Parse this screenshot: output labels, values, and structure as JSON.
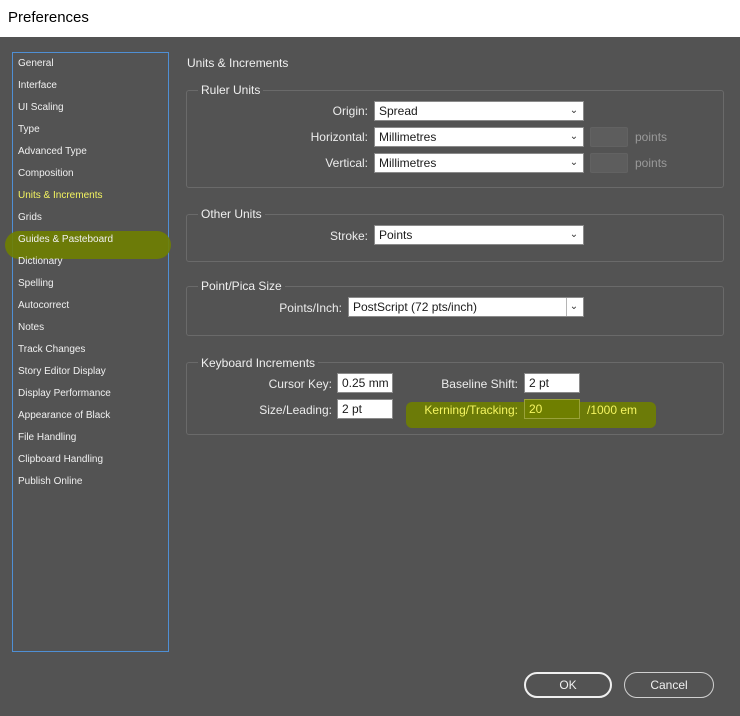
{
  "window": {
    "title": "Preferences"
  },
  "sidebar": {
    "items": [
      {
        "label": "General"
      },
      {
        "label": "Interface"
      },
      {
        "label": "UI Scaling"
      },
      {
        "label": "Type"
      },
      {
        "label": "Advanced Type"
      },
      {
        "label": "Composition"
      },
      {
        "label": "Units & Increments",
        "selected": true
      },
      {
        "label": "Grids"
      },
      {
        "label": "Guides & Pasteboard"
      },
      {
        "label": "Dictionary"
      },
      {
        "label": "Spelling"
      },
      {
        "label": "Autocorrect"
      },
      {
        "label": "Notes"
      },
      {
        "label": "Track Changes"
      },
      {
        "label": "Story Editor Display"
      },
      {
        "label": "Display Performance"
      },
      {
        "label": "Appearance of Black"
      },
      {
        "label": "File Handling"
      },
      {
        "label": "Clipboard Handling"
      },
      {
        "label": "Publish Online"
      }
    ]
  },
  "main": {
    "heading": "Units & Increments",
    "ruler_units": {
      "title": "Ruler Units",
      "origin_label": "Origin:",
      "origin_value": "Spread",
      "horizontal_label": "Horizontal:",
      "horizontal_value": "Millimetres",
      "horizontal_unit": "points",
      "vertical_label": "Vertical:",
      "vertical_value": "Millimetres",
      "vertical_unit": "points"
    },
    "other_units": {
      "title": "Other Units",
      "stroke_label": "Stroke:",
      "stroke_value": "Points"
    },
    "point_pica": {
      "title": "Point/Pica Size",
      "points_inch_label": "Points/Inch:",
      "points_inch_value": "PostScript (72 pts/inch)"
    },
    "keyboard_increments": {
      "title": "Keyboard Increments",
      "cursor_key_label": "Cursor Key:",
      "cursor_key_value": "0.25 mm",
      "baseline_shift_label": "Baseline Shift:",
      "baseline_shift_value": "2 pt",
      "size_leading_label": "Size/Leading:",
      "size_leading_value": "2 pt",
      "kerning_label": "Kerning/Tracking:",
      "kerning_value": "20",
      "kerning_unit": "/1000 em"
    }
  },
  "buttons": {
    "ok": "OK",
    "cancel": "Cancel"
  },
  "colors": {
    "background": "#535353",
    "highlight": "#6f7f00",
    "highlight_text": "#f4f460",
    "selection_border": "#4f8fd4"
  }
}
